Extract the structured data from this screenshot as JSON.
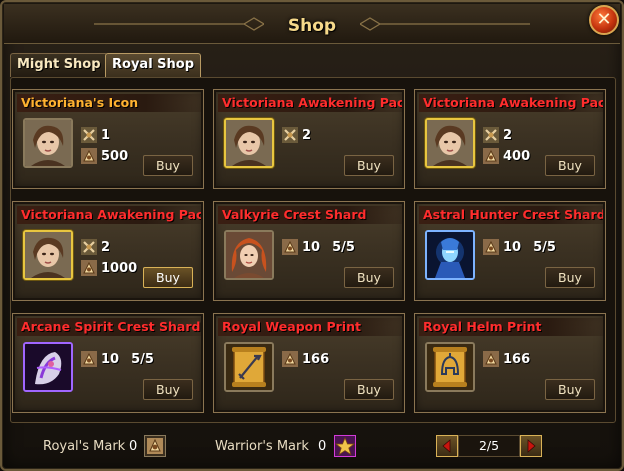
{
  "window": {
    "title": "Shop",
    "close_label": "✕"
  },
  "tabs": [
    {
      "label": "Might Shop",
      "active": false
    },
    {
      "label": "Royal Shop",
      "active": true
    }
  ],
  "items": [
    {
      "title": "Victoriana's Icon",
      "title_color": "orange",
      "icon": "victoriana-portrait-icon",
      "frame": "plain",
      "cost_rows": [
        {
          "currency": "warrior-mark-icon",
          "amount": "1"
        },
        {
          "currency": "royal-mark-icon",
          "amount": "500"
        }
      ],
      "buy_label": "Buy"
    },
    {
      "title": "Victoriana Awakening Pack",
      "title_color": "red",
      "icon": "victoriana-portrait-icon",
      "frame": "gold",
      "cost_rows": [
        {
          "currency": "warrior-mark-icon",
          "amount": "2"
        }
      ],
      "buy_label": "Buy"
    },
    {
      "title": "Victoriana Awakening Pack",
      "title_color": "red",
      "icon": "victoriana-portrait-icon",
      "frame": "gold",
      "cost_rows": [
        {
          "currency": "warrior-mark-icon",
          "amount": "2"
        },
        {
          "currency": "royal-mark-icon",
          "amount": "400"
        }
      ],
      "buy_label": "Buy"
    },
    {
      "title": "Victoriana Awakening Pack",
      "title_color": "red",
      "icon": "victoriana-portrait-icon",
      "frame": "gold",
      "cost_rows": [
        {
          "currency": "warrior-mark-icon",
          "amount": "2"
        },
        {
          "currency": "royal-mark-icon",
          "amount": "1000"
        }
      ],
      "buy_label": "Buy",
      "highlight": true
    },
    {
      "title": "Valkyrie Crest Shard",
      "title_color": "red",
      "icon": "valkyrie-portrait-icon",
      "frame": "plain",
      "cost_rows": [
        {
          "currency": "royal-mark-icon",
          "amount": "10",
          "stock": "5/5"
        }
      ],
      "buy_label": "Buy"
    },
    {
      "title": "Astral Hunter Crest Shard",
      "title_color": "red",
      "icon": "astral-hunter-portrait-icon",
      "frame": "blue",
      "cost_rows": [
        {
          "currency": "royal-mark-icon",
          "amount": "10",
          "stock": "5/5"
        }
      ],
      "buy_label": "Buy"
    },
    {
      "title": "Arcane Spirit Crest Shard",
      "title_color": "red",
      "icon": "arcane-spirit-portrait-icon",
      "frame": "purple",
      "cost_rows": [
        {
          "currency": "royal-mark-icon",
          "amount": "10",
          "stock": "5/5"
        }
      ],
      "buy_label": "Buy"
    },
    {
      "title": "Royal Weapon Print",
      "title_color": "red",
      "icon": "weapon-scroll-icon",
      "frame": "plain",
      "cost_rows": [
        {
          "currency": "royal-mark-icon",
          "amount": "166"
        }
      ],
      "buy_label": "Buy"
    },
    {
      "title": "Royal Helm Print",
      "title_color": "red",
      "icon": "helm-scroll-icon",
      "frame": "plain",
      "cost_rows": [
        {
          "currency": "royal-mark-icon",
          "amount": "166"
        }
      ],
      "buy_label": "Buy"
    }
  ],
  "footer": {
    "royal_mark_label": "Royal's Mark",
    "royal_mark_count": "0",
    "warrior_mark_label": "Warrior's Mark",
    "warrior_mark_count": "0",
    "page_indicator": "2/5"
  }
}
